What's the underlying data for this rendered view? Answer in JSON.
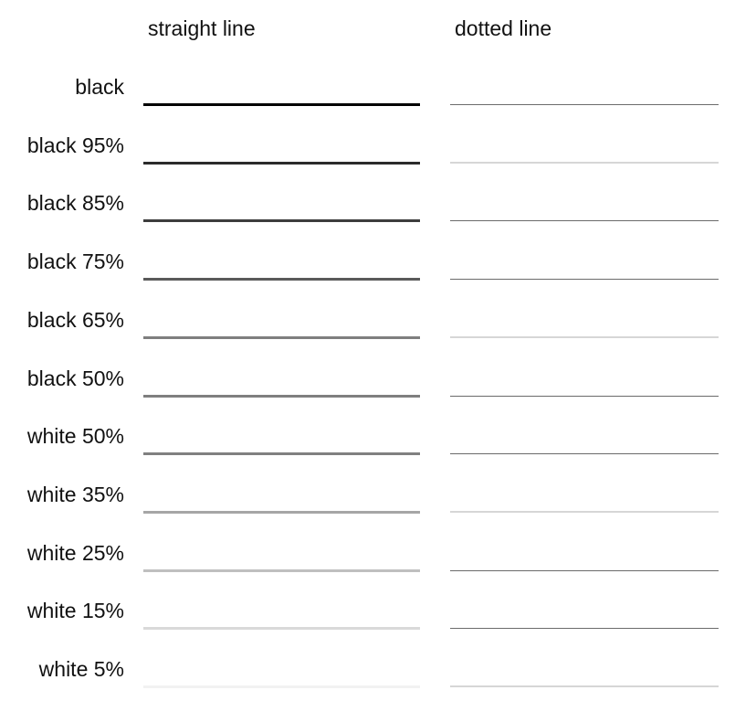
{
  "headers": {
    "straight": "straight line",
    "dotted": "dotted line"
  },
  "rows": [
    {
      "label": "black",
      "straight_color": "#000000",
      "dotted_color": "#6b6b6b",
      "dotted_style": "dark"
    },
    {
      "label": "black 95%",
      "straight_color": "#2b2b2b",
      "dotted_color": "#d6d6d6",
      "dotted_style": "light"
    },
    {
      "label": "black 85%",
      "straight_color": "#3d3d3d",
      "dotted_color": "#6b6b6b",
      "dotted_style": "dark"
    },
    {
      "label": "black 75%",
      "straight_color": "#5a5a5a",
      "dotted_color": "#6b6b6b",
      "dotted_style": "dark"
    },
    {
      "label": "black 65%",
      "straight_color": "#7f7f7f",
      "dotted_color": "#d6d6d6",
      "dotted_style": "light"
    },
    {
      "label": "black 50%",
      "straight_color": "#7f7f7f",
      "dotted_color": "#6b6b6b",
      "dotted_style": "dark"
    },
    {
      "label": "white 50%",
      "straight_color": "#808080",
      "dotted_color": "#6b6b6b",
      "dotted_style": "dark"
    },
    {
      "label": "white 35%",
      "straight_color": "#a6a6a6",
      "dotted_color": "#d6d6d6",
      "dotted_style": "light"
    },
    {
      "label": "white 25%",
      "straight_color": "#bfbfbf",
      "dotted_color": "#6b6b6b",
      "dotted_style": "dark"
    },
    {
      "label": "white 15%",
      "straight_color": "#d9d9d9",
      "dotted_color": "#6b6b6b",
      "dotted_style": "dark"
    },
    {
      "label": "white 5%",
      "straight_color": "#f2f2f2",
      "dotted_color": "#d6d6d6",
      "dotted_style": "light"
    }
  ]
}
